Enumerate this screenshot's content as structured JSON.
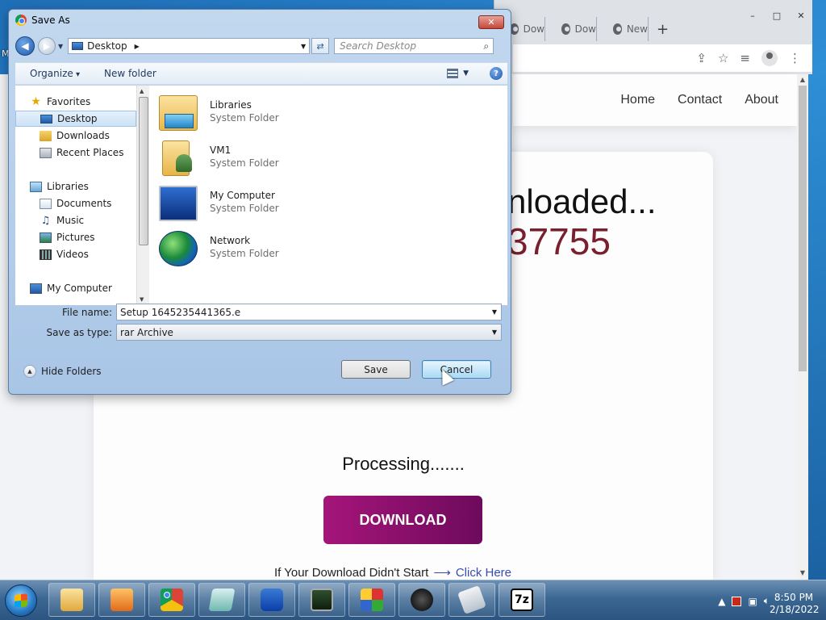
{
  "browser": {
    "tabs": [
      "Dow",
      "Dow",
      "New"
    ],
    "new_tab_symbol": "+",
    "window_controls": [
      "–",
      "□",
      "✕"
    ],
    "toolbar_icons": [
      "share-icon",
      "star-icon",
      "media-icon",
      "profile-icon",
      "menu-icon"
    ]
  },
  "site": {
    "nav": [
      "Home",
      "Contact",
      "About"
    ],
    "headline": "nloaded...",
    "number": "37755",
    "processing": "Processing.......",
    "download_label": "DOWNLOAD",
    "didnt_start": "If Your Download Didn't Start",
    "arrow": "⟶",
    "click_here": "Click Here",
    "accent": "#7a1f2e",
    "button_color": "#a5157a"
  },
  "dialog": {
    "title": "Save As",
    "close_label": "✕",
    "address": "Desktop",
    "search_placeholder": "Search Desktop",
    "organize": "Organize",
    "new_folder": "New folder",
    "help": "?",
    "nav_items": [
      {
        "label": "Favorites",
        "icon": "star-icon",
        "depth": 0
      },
      {
        "label": "Desktop",
        "icon": "desktop-icon",
        "depth": 1,
        "selected": true
      },
      {
        "label": "Downloads",
        "icon": "downloads-icon",
        "depth": 1
      },
      {
        "label": "Recent Places",
        "icon": "recent-places-icon",
        "depth": 1
      },
      {
        "label": "Libraries",
        "icon": "libraries-icon",
        "depth": 0
      },
      {
        "label": "Documents",
        "icon": "documents-icon",
        "depth": 1
      },
      {
        "label": "Music",
        "icon": "music-icon",
        "depth": 1
      },
      {
        "label": "Pictures",
        "icon": "pictures-icon",
        "depth": 1
      },
      {
        "label": "Videos",
        "icon": "videos-icon",
        "depth": 1
      },
      {
        "label": "My Computer",
        "icon": "computer-icon",
        "depth": 0
      }
    ],
    "files": [
      {
        "name": "Libraries",
        "type": "System Folder",
        "icon": "libraries-folder-icon"
      },
      {
        "name": "VM1",
        "type": "System Folder",
        "icon": "user-folder-icon"
      },
      {
        "name": "My Computer",
        "type": "System Folder",
        "icon": "computer-icon"
      },
      {
        "name": "Network",
        "type": "System Folder",
        "icon": "network-icon"
      }
    ],
    "file_name_label": "File name:",
    "file_name_value": "Setup 1645235441365.e",
    "save_type_label": "Save as type:",
    "save_type_value": "rar Archive",
    "hide_folders": "Hide Folders",
    "save": "Save",
    "cancel": "Cancel"
  },
  "desktop": {
    "edge_letters": [
      "M",
      "D",
      "M"
    ]
  },
  "taskbar": {
    "apps": [
      "explorer-icon",
      "media-player-icon",
      "chrome-icon",
      "notepad-icon",
      "malwarebytes-icon",
      "task-manager-icon",
      "winrar-icon",
      "anonymous-icon",
      "installer-icon",
      "7zip-icon"
    ],
    "seven_zip_label": "7z",
    "time": "8:50 PM",
    "date": "2/18/2022"
  }
}
